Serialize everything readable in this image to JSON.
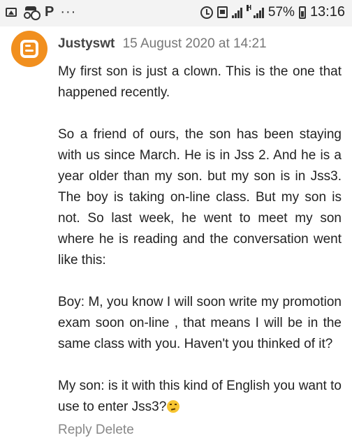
{
  "status_bar": {
    "battery_percent": "57%",
    "time": "13:16",
    "signal_label": "H",
    "icons": [
      "image-icon",
      "incognito-icon",
      "p-app-icon",
      "more-dots-icon",
      "alarm-icon",
      "calendar-icon",
      "signal-icon",
      "battery-icon"
    ]
  },
  "comment": {
    "avatar": "blogger-icon",
    "author": "Justyswt",
    "date": "15 August 2020 at 14:21",
    "paragraphs": [
      "My first son is just a clown. This is the one that happened recently.",
      "So a friend of ours, the son has been staying with us since March. He is in Jss 2. And he is a year older than my son. but my son is in Jss3. The boy is taking on-line class. But my son is not. So last week, he went to meet my son where he is reading and the conversation went like this:",
      "Boy: M, you know I will soon write my promotion exam soon on-line , that means I will be in the same class with you. Haven't you thinked of it?",
      "My son: is it with this kind of English you want to use to enter Jss3?"
    ],
    "emoji": "unamused-face-icon",
    "actions": {
      "reply": "Reply",
      "delete": "Delete"
    }
  },
  "colors": {
    "avatar_bg": "#f18f1e",
    "text": "#222222",
    "muted": "#888888"
  }
}
